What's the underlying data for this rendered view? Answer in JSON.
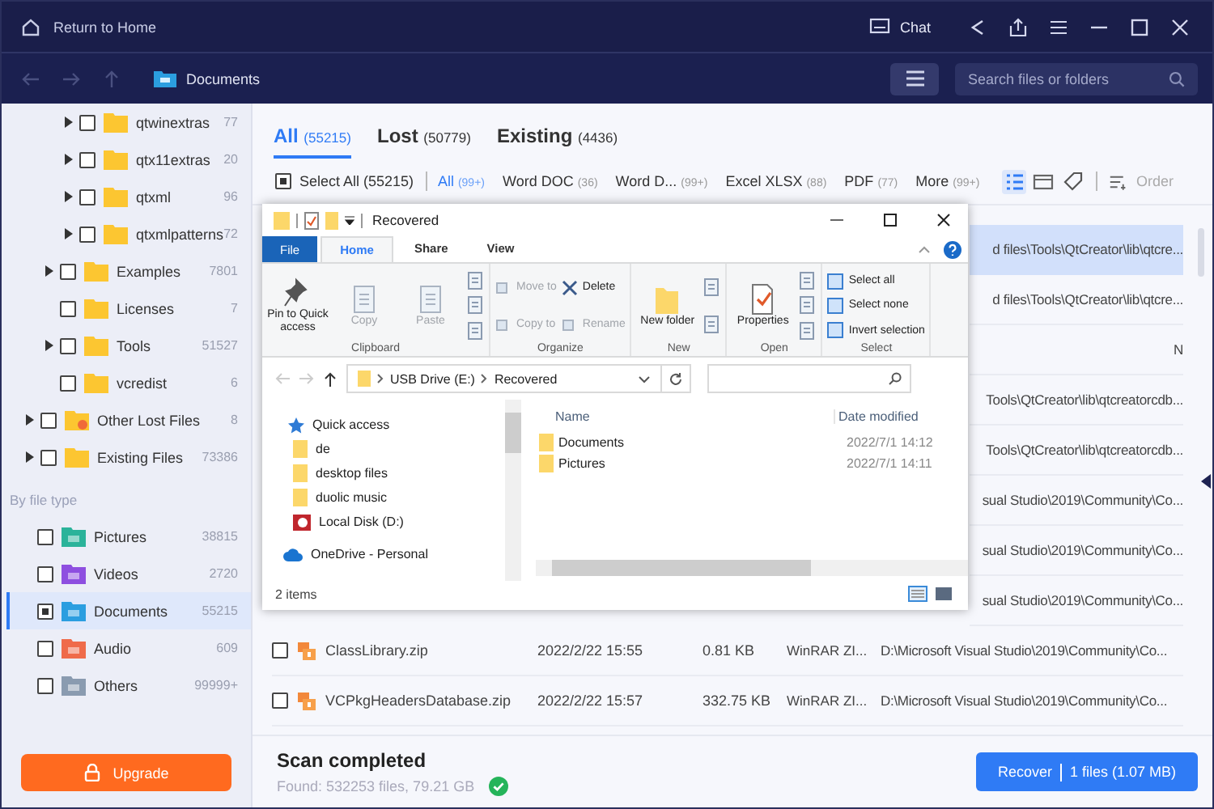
{
  "titlebar": {
    "home_link": "Return to Home",
    "chat": "Chat"
  },
  "navbar": {
    "location": "Documents",
    "search": {
      "placeholder": "Search files or folders"
    }
  },
  "sidebar": {
    "tree": [
      {
        "children": [
          {
            "children": [
              {
                "label": "qtwinextras",
                "count": "77",
                "expandable": true,
                "checked": false,
                "kind": "folder"
              },
              {
                "label": "qtx11extras",
                "count": "20",
                "expandable": true,
                "checked": false,
                "kind": "folder"
              },
              {
                "label": "qtxml",
                "count": "96",
                "expandable": true,
                "checked": false,
                "kind": "folder"
              },
              {
                "label": "qtxmlpatterns",
                "count": "72",
                "expandable": true,
                "checked": false,
                "kind": "folder"
              }
            ]
          },
          {
            "label": "Examples",
            "count": "7801",
            "expandable": true,
            "checked": false,
            "kind": "folder"
          },
          {
            "label": "Licenses",
            "count": "7",
            "expandable": false,
            "checked": false,
            "kind": "folder"
          },
          {
            "label": "Tools",
            "count": "51527",
            "expandable": true,
            "checked": false,
            "kind": "folder"
          },
          {
            "label": "vcredist",
            "count": "6",
            "expandable": false,
            "checked": false,
            "kind": "folder"
          }
        ]
      },
      {
        "label": "Other Lost Files",
        "count": "8",
        "expandable": true,
        "checked": false,
        "kind": "lost"
      },
      {
        "label": "Existing Files",
        "count": "73386",
        "expandable": true,
        "checked": false,
        "kind": "folder"
      }
    ],
    "section_title": "By file type",
    "file_types": [
      {
        "label": "Pictures",
        "count": "38815",
        "checked": false,
        "selected": false,
        "color": "#2bb39a"
      },
      {
        "label": "Videos",
        "count": "2720",
        "checked": false,
        "selected": false,
        "color": "#8e4fe0"
      },
      {
        "label": "Documents",
        "count": "55215",
        "checked": true,
        "selected": true,
        "color": "#2b9ee0"
      },
      {
        "label": "Audio",
        "count": "609",
        "checked": false,
        "selected": false,
        "color": "#ef6b4a"
      },
      {
        "label": "Others",
        "count": "99999+",
        "checked": false,
        "selected": false,
        "color": "#8a9bb0"
      }
    ],
    "upgrade": "Upgrade"
  },
  "tabs": [
    {
      "label": "All",
      "count": "(55215)",
      "selected": true
    },
    {
      "label": "Lost",
      "count": "(50779)",
      "selected": false
    },
    {
      "label": "Existing",
      "count": "(4436)",
      "selected": false
    }
  ],
  "filters": {
    "select_all": {
      "label": "Select All (55215)",
      "indeterminate": true
    },
    "chips": [
      {
        "label": "All",
        "count": "(99+)",
        "selected": true
      },
      {
        "label": "Word DOC",
        "count": "(36)",
        "selected": false
      },
      {
        "label": "Word D...",
        "count": "(99+)",
        "selected": false
      },
      {
        "label": "Excel XLSX",
        "count": "(88)",
        "selected": false
      },
      {
        "label": "PDF",
        "count": "(77)",
        "selected": false
      },
      {
        "label": "More",
        "count": "(99+)",
        "selected": false
      }
    ],
    "views": [
      {
        "kind": "list",
        "selected": true
      },
      {
        "kind": "grid",
        "selected": false
      },
      {
        "kind": "tag",
        "selected": false
      }
    ],
    "order": "Order"
  },
  "rows": [
    {
      "kind": "partial",
      "path": "d files\\Tools\\QtCreator\\lib\\qtcre...",
      "highlighted": true
    },
    {
      "kind": "partial",
      "path": "d files\\Tools\\QtCreator\\lib\\qtcre...",
      "highlighted": false
    },
    {
      "kind": "partial",
      "path": "N",
      "highlighted": false
    },
    {
      "kind": "partial",
      "path": "Tools\\QtCreator\\lib\\qtcreatorcdb...",
      "highlighted": false
    },
    {
      "kind": "partial",
      "path": "Tools\\QtCreator\\lib\\qtcreatorcdb...",
      "highlighted": false
    },
    {
      "kind": "partial",
      "path": "sual Studio\\2019\\Community\\Co...",
      "highlighted": false
    },
    {
      "kind": "partial",
      "path": "sual Studio\\2019\\Community\\Co...",
      "highlighted": false
    },
    {
      "kind": "partial",
      "path": "sual Studio\\2019\\Community\\Co...",
      "highlighted": false
    },
    {
      "kind": "file",
      "name": "ClassLibrary.zip",
      "date": "2022/2/22 15:55",
      "size": "0.81 KB",
      "type": "WinRAR ZI...",
      "path": "D:\\Microsoft Visual Studio\\2019\\Community\\Co...",
      "checked": false,
      "highlighted": false
    },
    {
      "kind": "file",
      "name": "VCPkgHeadersDatabase.zip",
      "date": "2022/2/22 15:57",
      "size": "332.75 KB",
      "type": "WinRAR ZI...",
      "path": "D:\\Microsoft Visual Studio\\2019\\Community\\Co...",
      "checked": false,
      "highlighted": false
    }
  ],
  "footer": {
    "status": "Scan completed",
    "found": "Found: 532253 files, 79.21 GB",
    "recover": "Recover",
    "recover_detail": "1 files (1.07 MB)"
  },
  "explorer": {
    "title": "Recovered",
    "ribbon_tabs": [
      {
        "label": "File",
        "kind": "file",
        "selected": false
      },
      {
        "label": "Home",
        "kind": "tab",
        "selected": true
      },
      {
        "label": "Share",
        "kind": "tab",
        "selected": false
      },
      {
        "label": "View",
        "kind": "tab",
        "selected": false
      }
    ],
    "ribbon_groups": [
      {
        "label": "Clipboard",
        "columns": [
          [
            {
              "kind": "large",
              "label": "Pin to Quick access",
              "disabled": false
            }
          ],
          [
            {
              "kind": "large",
              "label": "Copy",
              "disabled": true
            }
          ],
          [
            {
              "kind": "large",
              "label": "Paste",
              "disabled": true
            }
          ],
          [
            {
              "kind": "icon"
            },
            {
              "kind": "icon"
            },
            {
              "kind": "icon"
            }
          ]
        ]
      },
      {
        "label": "Organize",
        "columns": [
          [
            {
              "kind": "small",
              "label": "Move to",
              "disabled": true
            },
            {
              "kind": "small",
              "label": "Copy to",
              "disabled": true
            }
          ],
          [
            {
              "kind": "small",
              "label": "Delete",
              "disabled": false
            },
            {
              "kind": "small",
              "label": "Rename",
              "disabled": true
            }
          ]
        ]
      },
      {
        "label": "New",
        "columns": [
          [
            {
              "kind": "large",
              "label": "New folder",
              "disabled": false
            }
          ],
          [
            {
              "kind": "icon"
            },
            {
              "kind": "icon"
            }
          ]
        ]
      },
      {
        "label": "Open",
        "columns": [
          [
            {
              "kind": "large",
              "label": "Properties",
              "disabled": false
            }
          ],
          [
            {
              "kind": "icon"
            },
            {
              "kind": "icon"
            },
            {
              "kind": "icon"
            }
          ]
        ]
      },
      {
        "label": "Select",
        "columns": [
          [
            {
              "kind": "small",
              "label": "Select all",
              "disabled": false
            },
            {
              "kind": "small",
              "label": "Select none",
              "disabled": false
            },
            {
              "kind": "small",
              "label": "Invert selection",
              "disabled": false
            }
          ]
        ]
      }
    ],
    "address": [
      "USB Drive (E:)",
      "Recovered"
    ],
    "nav": [
      {
        "label": "Quick access",
        "kind": "quick"
      },
      {
        "label": "de",
        "kind": "folder"
      },
      {
        "label": "desktop files",
        "kind": "folder"
      },
      {
        "label": "duolic music",
        "kind": "folder"
      },
      {
        "label": "Local Disk (D:)",
        "kind": "disk"
      },
      {
        "label": "OneDrive - Personal",
        "kind": "cloud"
      }
    ],
    "columns": [
      "Name",
      "Date modified"
    ],
    "files": [
      {
        "name": "Documents",
        "date": "2022/7/1 14:12"
      },
      {
        "name": "Pictures",
        "date": "2022/7/1 14:11"
      }
    ],
    "status": "2 items"
  }
}
